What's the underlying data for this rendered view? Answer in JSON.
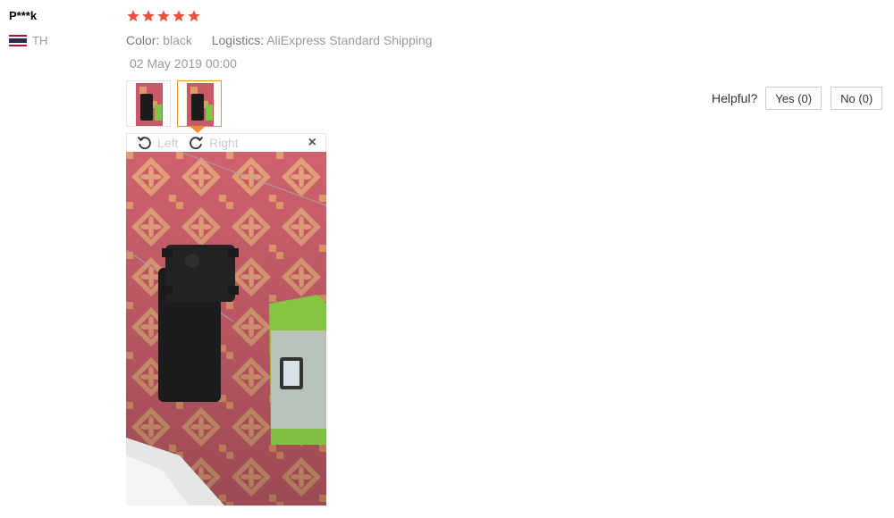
{
  "review": {
    "user": "P***k",
    "country": "TH",
    "rating": 5,
    "color_label": "Color:",
    "color_value": "black",
    "logistics_label": "Logistics:",
    "logistics_value": "AliExpress Standard Shipping",
    "date": "02 May 2019 00:00"
  },
  "viewer": {
    "rotate_left": "Left",
    "rotate_right": "Right",
    "close": "×"
  },
  "helpful": {
    "label": "Helpful?",
    "yes": "Yes (0)",
    "no": "No (0)"
  },
  "colors": {
    "star": "#e8513d",
    "thumb_active_border": "#ef8c36"
  },
  "icons": [
    "thailand-flag-icon",
    "star-icon",
    "rotate-left-icon",
    "rotate-right-icon",
    "close-icon"
  ]
}
